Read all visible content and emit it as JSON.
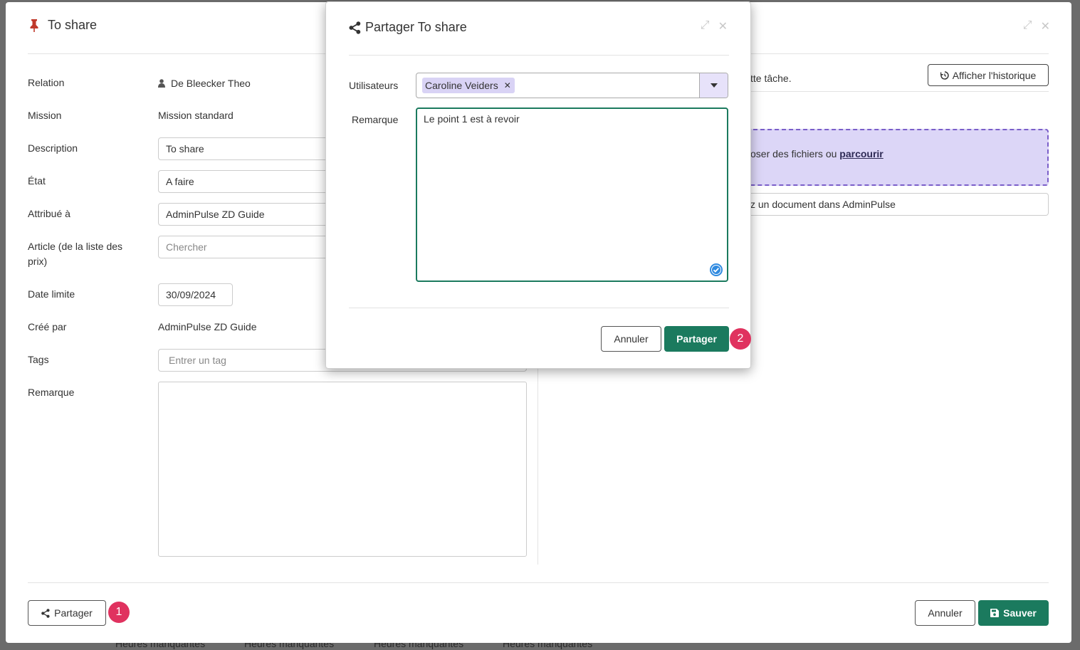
{
  "background": {
    "bottom_texts": [
      "Heures manquantes",
      "Heures manquantes",
      "Heures manquantes",
      "Heures manquantes"
    ]
  },
  "main_modal": {
    "title": "To share",
    "fields": {
      "relation": {
        "label": "Relation",
        "value": "De Bleecker Theo"
      },
      "mission": {
        "label": "Mission",
        "value": "Mission standard"
      },
      "description": {
        "label": "Description",
        "value": "To share"
      },
      "etat": {
        "label": "État",
        "value": "A faire"
      },
      "attribue": {
        "label": "Attribué à",
        "value": "AdminPulse ZD Guide"
      },
      "article": {
        "label": "Article (de la liste des prix)",
        "placeholder": "Chercher"
      },
      "date_limite": {
        "label": "Date limite",
        "value": "30/09/2024"
      },
      "cree_par": {
        "label": "Créé par",
        "value": "AdminPulse ZD Guide"
      },
      "tags": {
        "label": "Tags",
        "placeholder": "Entrer un tag"
      },
      "remarque": {
        "label": "Remarque",
        "value": ""
      }
    },
    "right_panel": {
      "history_button": "Afficher l'historique",
      "task_text": "tte tâche.",
      "drop_text": "oser des fichiers ou",
      "drop_link": "parcourir",
      "doc_field": "z un document dans AdminPulse"
    },
    "footer": {
      "share_button": "Partager",
      "share_badge": "1",
      "cancel_button": "Annuler",
      "save_button": "Sauver"
    }
  },
  "share_dialog": {
    "title": "Partager To share",
    "users_label": "Utilisateurs",
    "selected_user": "Caroline Veiders",
    "remark_label": "Remarque",
    "remark_value": "Le point 1 est à revoir",
    "cancel_button": "Annuler",
    "share_button": "Partager",
    "share_badge": "2"
  },
  "colors": {
    "primary_green": "#1b7a5e",
    "badge_pink": "#e0325f",
    "tag_lilac": "#d9d3f5",
    "pin_red": "#c0392b"
  }
}
